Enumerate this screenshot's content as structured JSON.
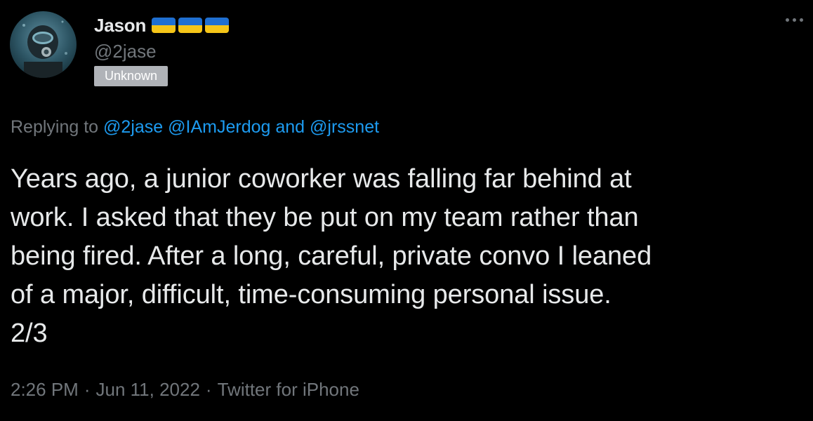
{
  "colors": {
    "background": "#000000",
    "primary_text": "#e7e9ea",
    "secondary_text": "#71767b",
    "link": "#1d9bf0",
    "badge_bg": "#b0b3b8",
    "flag_blue": "#1f6fd1",
    "flag_yellow": "#f5c518"
  },
  "author": {
    "display_name": "Jason",
    "flag_icons": [
      "ukraine-flag-icon",
      "ukraine-flag-icon",
      "ukraine-flag-icon"
    ],
    "handle": "@2jase",
    "badge": "Unknown",
    "avatar_icon": "diver-avatar"
  },
  "more_icon": "more-options-icon",
  "reply": {
    "prefix": "Replying to",
    "mention_1": "@2jase",
    "mention_2": "@IAmJerdog",
    "connector": "and",
    "mention_3": "@jrssnet"
  },
  "body": {
    "line_1": "Years ago, a junior coworker was falling far behind at",
    "line_2": "work. I asked that they be put on my team rather than",
    "line_3": "being fired. After a long, careful, private convo I leaned",
    "line_4": "of a major, difficult, time-consuming personal issue.",
    "line_5": "2/3"
  },
  "meta": {
    "time": "2:26 PM",
    "separator": "·",
    "date": "Jun 11, 2022",
    "source": "Twitter for iPhone"
  }
}
